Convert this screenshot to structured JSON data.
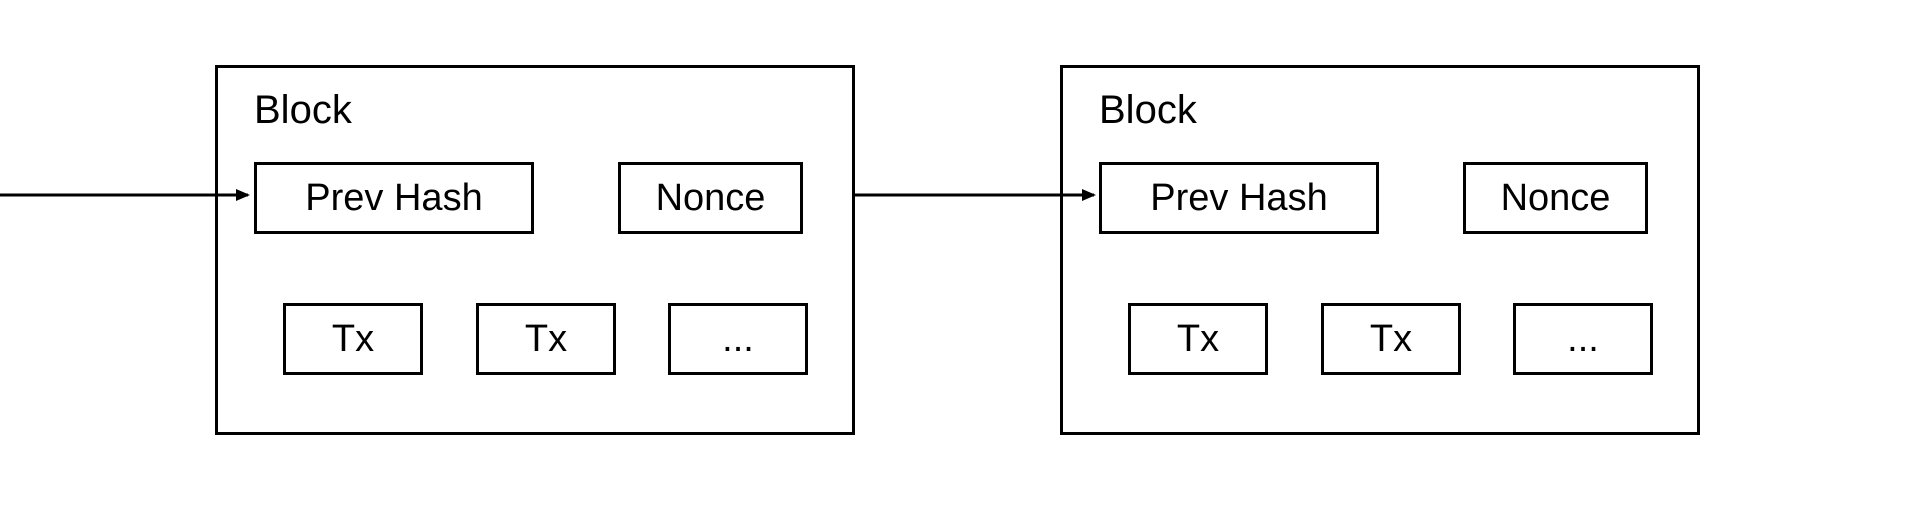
{
  "blocks": [
    {
      "title": "Block",
      "header": {
        "prev_hash": "Prev Hash",
        "nonce": "Nonce"
      },
      "txs": [
        "Tx",
        "Tx",
        "..."
      ]
    },
    {
      "title": "Block",
      "header": {
        "prev_hash": "Prev Hash",
        "nonce": "Nonce"
      },
      "txs": [
        "Tx",
        "Tx",
        "..."
      ]
    }
  ]
}
